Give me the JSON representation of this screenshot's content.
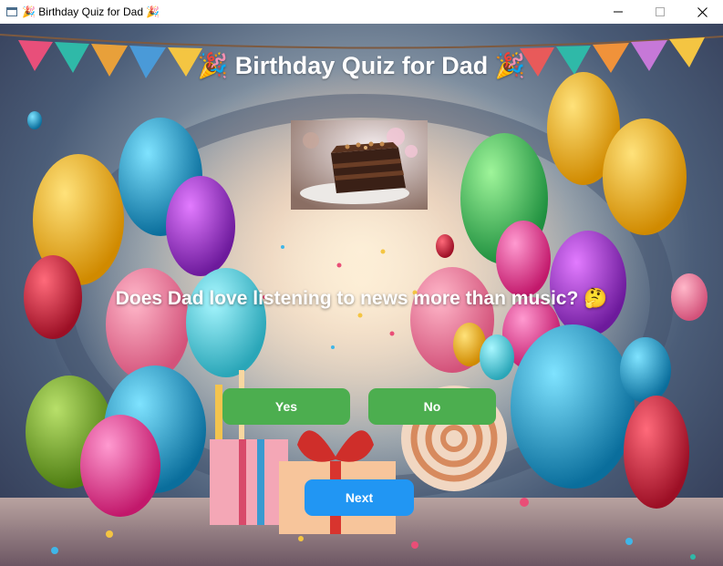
{
  "window": {
    "title": "🎉 Birthday Quiz for Dad 🎉",
    "icons": [
      "app-icon",
      "minimize-icon",
      "maximize-icon",
      "close-icon"
    ]
  },
  "quiz": {
    "title": "🎉 Birthday Quiz for Dad 🎉",
    "question": "Does Dad love listening to news more than music? 🤔",
    "answers": {
      "yes_label": "Yes",
      "no_label": "No"
    },
    "next_label": "Next"
  },
  "colors": {
    "answer_button": "#4cae4f",
    "next_button": "#2196f3",
    "text": "#ffffff"
  }
}
